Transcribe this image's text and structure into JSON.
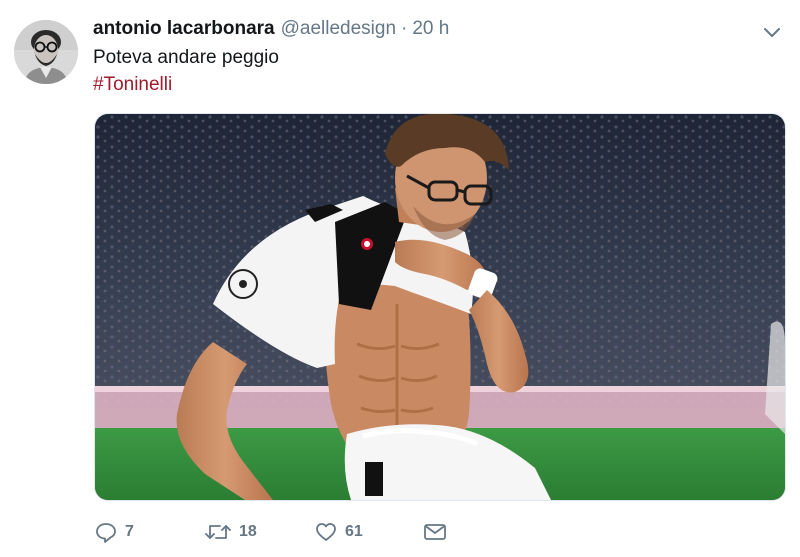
{
  "tweet": {
    "author_name": "antonio lacarbonara",
    "handle": "@aelledesign",
    "separator": "·",
    "time": "20 h",
    "text": "Poteva andare peggio",
    "hashtag": "#Toninelli",
    "replies": "7",
    "retweets": "18",
    "likes": "61"
  },
  "icons": {
    "menu": "chevron-down-icon",
    "reply": "reply-icon",
    "retweet": "retweet-icon",
    "like": "heart-icon",
    "share": "mail-icon"
  },
  "colors": {
    "name": "#14171a",
    "secondary": "#657786",
    "hashtag": "#a11a2d",
    "pitch": "#2f8a3a"
  }
}
